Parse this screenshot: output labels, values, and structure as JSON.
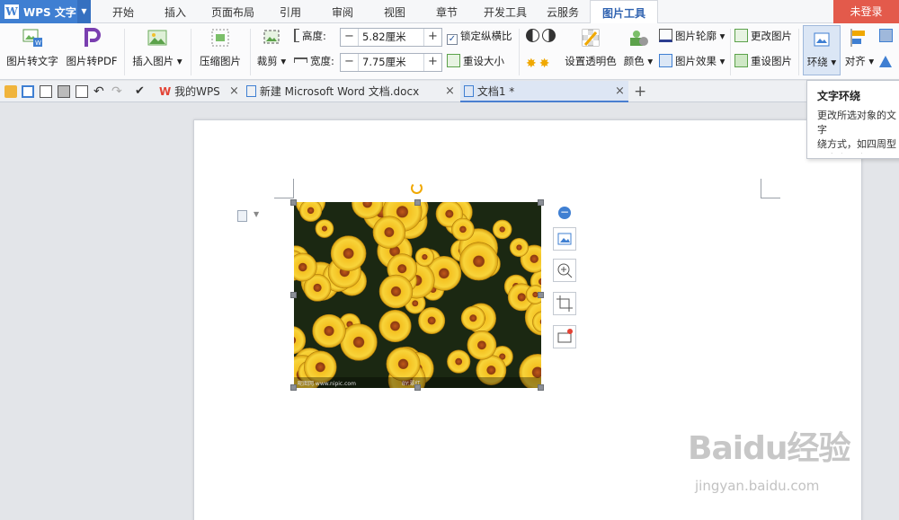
{
  "app": {
    "logo_letter": "W",
    "name": "WPS 文字"
  },
  "ribbon_tabs": [
    "开始",
    "插入",
    "页面布局",
    "引用",
    "审阅",
    "视图",
    "章节",
    "开发工具",
    "云服务",
    "图片工具"
  ],
  "active_tab": "图片工具",
  "login_label": "未登录",
  "toolbar": {
    "pic_to_text": "图片转文字",
    "pic_to_pdf": "图片转PDF",
    "insert_picture": "插入图片",
    "compress_picture": "压缩图片",
    "crop": "裁剪",
    "height_label": "高度:",
    "height_value": "5.82厘米",
    "width_label": "宽度:",
    "width_value": "7.75厘米",
    "lock_ratio": "锁定纵横比",
    "reset_size": "重设大小",
    "set_transparent": "设置透明色",
    "color": "颜色",
    "picture_outline": "图片轮廓",
    "picture_effect": "图片效果",
    "change_picture": "更改图片",
    "reset_picture": "重设图片",
    "wrap": "环绕",
    "align": "对齐"
  },
  "doc_tabs": [
    {
      "label": "我的WPS"
    },
    {
      "label": "新建 Microsoft Word 文档.docx"
    },
    {
      "label": "文档1 *"
    }
  ],
  "tooltip": {
    "title": "文字环绕",
    "body": "更改所选对象的文字\n绕方式，如四周型\n于文字下方。"
  },
  "image_watermark": {
    "left": "昵图网 www.nipic.com",
    "mid": "BY:翠红"
  },
  "watermark": {
    "logo": "Baidu经验",
    "url": "jingyan.baidu.com"
  },
  "colors": {
    "accent": "#3f7fd2",
    "login": "#e35a4b",
    "active_tab_text": "#2f62b0"
  }
}
